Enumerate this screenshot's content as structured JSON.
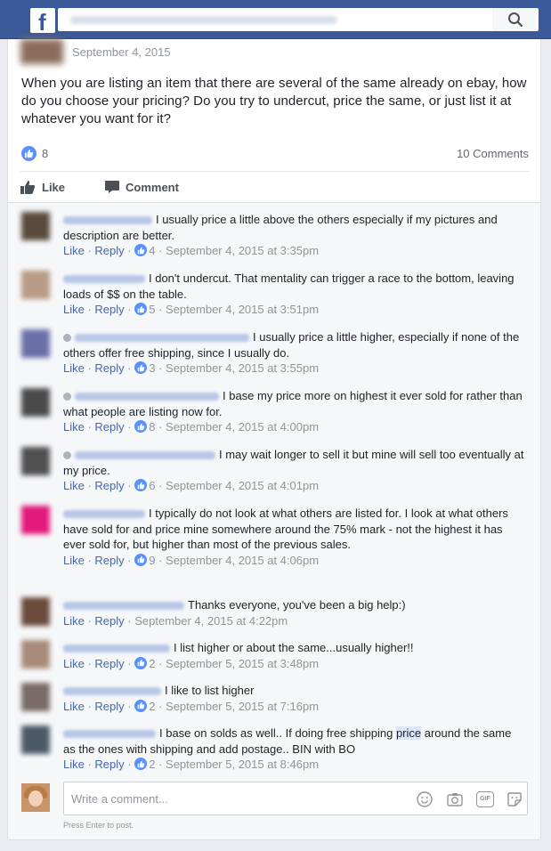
{
  "topbar": {
    "logo": "f",
    "search_value": "",
    "search_icon": "search-icon"
  },
  "post": {
    "date": "September 4, 2015",
    "text": "When you are listing an item that there are several of the same already on ebay, how do you choose your pricing? Do you try to undercut, price the same, or just list it at whatever you want for it?",
    "likes": "8",
    "comments_count": "10 Comments",
    "actions": {
      "like": "Like",
      "comment": "Comment"
    }
  },
  "colors": {
    "brand": "#3b5998",
    "link": "#4267b2",
    "like_blue": "#5890ff"
  },
  "comments": [
    {
      "text": "I usually price a little above the others especially if my pictures and description are better.",
      "like": "Like",
      "reply": "Reply",
      "reactions": "4",
      "time": "September 4, 2015 at 3:35pm"
    },
    {
      "text": "I don't undercut. That mentality can trigger a race to the bottom, leaving loads of $$ on the table.",
      "like": "Like",
      "reply": "Reply",
      "reactions": "5",
      "time": "September 4, 2015 at 3:51pm"
    },
    {
      "text": "I usually price a little higher, especially if none of the others offer free shipping, since I usually do.",
      "like": "Like",
      "reply": "Reply",
      "reactions": "3",
      "time": "September 4, 2015 at 3:55pm"
    },
    {
      "text": "I base my price more on highest it ever sold for rather than what people are listing now for.",
      "like": "Like",
      "reply": "Reply",
      "reactions": "8",
      "time": "September 4, 2015 at 4:00pm"
    },
    {
      "text": "I may wait longer to sell it but mine will sell too eventually at my price.",
      "like": "Like",
      "reply": "Reply",
      "reactions": "6",
      "time": "September 4, 2015 at 4:01pm"
    },
    {
      "text": "I typically do not look at what others are listed for. I look at what others have sold for and price mine somewhere around the 75% mark - not the highest it has ever sold for, but higher than most of the previous sales.",
      "like": "Like",
      "reply": "Reply",
      "reactions": "9",
      "time": "September 4, 2015 at 4:06pm"
    },
    {
      "text": "Thanks everyone, you've been a big help:)",
      "like": "Like",
      "reply": "Reply",
      "reactions": "",
      "time": "September 4, 2015 at 4:22pm"
    },
    {
      "text": "I list higher or about the same...usually higher!!",
      "like": "Like",
      "reply": "Reply",
      "reactions": "2",
      "time": "September 5, 2015 at 3:48pm"
    },
    {
      "text": "I like to list higher",
      "like": "Like",
      "reply": "Reply",
      "reactions": "2",
      "time": "September 5, 2015 at 7:16pm"
    },
    {
      "text_before": "I base on solds as well.. If doing free shipping ",
      "text_highlight": "price",
      "text_after": " around the same as the ones with shipping and add postage.. BIN with BO",
      "like": "Like",
      "reply": "Reply",
      "reactions": "2",
      "time": "September 5, 2015 at 8:46pm"
    }
  ],
  "composer": {
    "placeholder": "Write a comment...",
    "hint": "Press Enter to post.",
    "icons": [
      "emoji-icon",
      "camera-icon",
      "gif-icon",
      "sticker-icon"
    ],
    "gif_label": "GIF"
  }
}
